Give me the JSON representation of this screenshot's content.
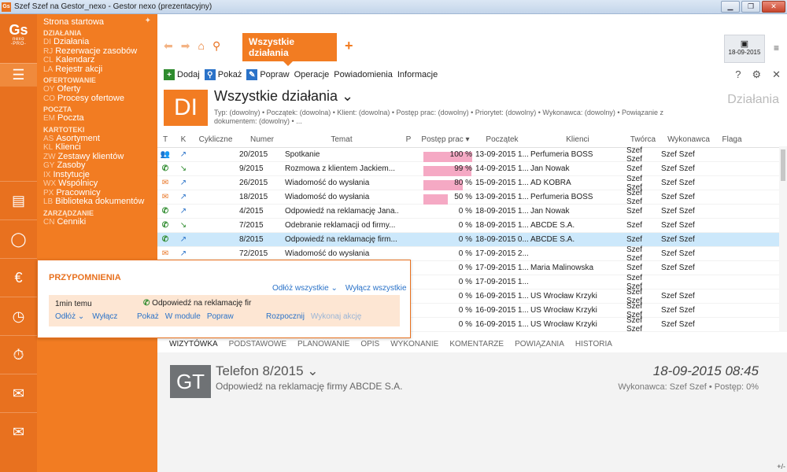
{
  "window": {
    "title": "Szef Szef na Gestor_nexo - Gestor nexo (prezentacyjny)",
    "app_badge": "Gs"
  },
  "logo": {
    "main": "Gs",
    "line1": "nexo",
    "line2": "-PRO-"
  },
  "nav": {
    "start": "Strona startowa",
    "sections": [
      {
        "title": "DZIAŁANIA",
        "items": [
          {
            "code": "DI",
            "label": "Działania"
          },
          {
            "code": "RJ",
            "label": "Rezerwacje zasobów"
          },
          {
            "code": "CL",
            "label": "Kalendarz"
          },
          {
            "code": "LA",
            "label": "Rejestr akcji"
          }
        ]
      },
      {
        "title": "OFERTOWANIE",
        "items": [
          {
            "code": "OY",
            "label": "Oferty"
          },
          {
            "code": "CO",
            "label": "Procesy ofertowe"
          }
        ]
      },
      {
        "title": "POCZTA",
        "items": [
          {
            "code": "EM",
            "label": "Poczta"
          }
        ]
      },
      {
        "title": "KARTOTEKI",
        "items": [
          {
            "code": "AS",
            "label": "Asortyment"
          },
          {
            "code": "KL",
            "label": "Klienci"
          },
          {
            "code": "ZW",
            "label": "Zestawy klientów"
          },
          {
            "code": "GY",
            "label": "Zasoby"
          },
          {
            "code": "IX",
            "label": "Instytucje"
          },
          {
            "code": "WX",
            "label": "Wspólnicy"
          },
          {
            "code": "PX",
            "label": "Pracownicy"
          },
          {
            "code": "LB",
            "label": "Biblioteka dokumentów"
          }
        ]
      },
      {
        "title": "ZARZĄDZANIE",
        "items": [
          {
            "code": "CN",
            "label": "Cenniki"
          }
        ]
      }
    ]
  },
  "tabs": {
    "active": "Wszystkie działania"
  },
  "datebox": {
    "date": "18-09-2015"
  },
  "commands": {
    "add": "Dodaj",
    "show": "Pokaż",
    "edit": "Popraw",
    "ops": "Operacje",
    "notif": "Powiadomienia",
    "info": "Informacje"
  },
  "header": {
    "badge": "DI",
    "title": "Wszystkie działania ⌄",
    "filter": "Typ: (dowolny) • Początek: (dowolna) • Klient: (dowolna) • Postęp prac: (dowolny) • Priorytet: (dowolny) • Wykonawca: (dowolny) • Powiązanie z dokumentem: (dowolny) • ...",
    "right": "Działania"
  },
  "columns": {
    "t": "T",
    "k": "K",
    "cyc": "Cykliczne",
    "num": "Numer",
    "tem": "Temat",
    "p": "P",
    "post": "Postęp prac ▾",
    "pocz": "Początek",
    "kli": "Klienci",
    "tw": "Twórca",
    "wyk": "Wykonawca",
    "fl": "Flaga"
  },
  "rows": [
    {
      "type": "person",
      "dir": "out",
      "num": "20/2015",
      "subject": "Spotkanie",
      "progress": 100,
      "progress_label": "100 %",
      "start": "13-09-2015 1...",
      "client": "Perfumeria BOSS",
      "creator": "Szef Szef",
      "executor": "Szef Szef"
    },
    {
      "type": "phone",
      "dir": "in",
      "num": "9/2015",
      "subject": "Rozmowa z klientem Jackiem...",
      "progress": 99,
      "progress_label": "99 %",
      "start": "14-09-2015 1...",
      "client": "Jan Nowak",
      "creator": "Szef",
      "executor": "Szef Szef"
    },
    {
      "type": "mail",
      "dir": "out",
      "num": "26/2015",
      "subject": "Wiadomość do wysłania",
      "progress": 80,
      "progress_label": "80 %",
      "start": "15-09-2015 1...",
      "client": "AD KOBRA",
      "creator": "Szef Szef",
      "executor": "Szef Szef"
    },
    {
      "type": "mail",
      "dir": "out",
      "num": "18/2015",
      "subject": "Wiadomość do wysłania",
      "progress": 50,
      "progress_label": "50 %",
      "start": "13-09-2015 1...",
      "client": "Perfumeria BOSS",
      "creator": "Szef Szef",
      "executor": "Szef Szef"
    },
    {
      "type": "phone",
      "dir": "out",
      "num": "4/2015",
      "subject": "Odpowiedź na reklamację Jana...",
      "progress": 0,
      "progress_label": "0 %",
      "start": "18-09-2015 1...",
      "client": "Jan Nowak",
      "creator": "Szef",
      "executor": "Szef Szef"
    },
    {
      "type": "phone",
      "dir": "in",
      "num": "7/2015",
      "subject": "Odebranie reklamacji od firmy...",
      "progress": 0,
      "progress_label": "0 %",
      "start": "18-09-2015 1...",
      "client": "ABCDE S.A.",
      "creator": "Szef",
      "executor": "Szef Szef"
    },
    {
      "type": "phone",
      "dir": "out",
      "num": "8/2015",
      "subject": "Odpowiedź na reklamację firm...",
      "progress": 0,
      "progress_label": "0 %",
      "start": "18-09-2015 0...",
      "client": "ABCDE S.A.",
      "creator": "Szef",
      "executor": "Szef Szef",
      "selected": true
    },
    {
      "type": "mail",
      "dir": "out",
      "num": "72/2015",
      "subject": "Wiadomość do wysłania",
      "progress": 0,
      "progress_label": "0 %",
      "start": "17-09-2015 2...",
      "client": "",
      "creator": "Szef Szef",
      "executor": "Szef Szef"
    },
    {
      "type": "",
      "dir": "",
      "num": "",
      "subject": "",
      "progress": 0,
      "progress_label": "0 %",
      "start": "17-09-2015 1...",
      "client": "Maria Malinowska",
      "creator": "Szef",
      "executor": "Szef Szef"
    },
    {
      "type": "",
      "dir": "",
      "num": "",
      "subject": "",
      "progress": 0,
      "progress_label": "0 %",
      "start": "17-09-2015 1...",
      "client": "",
      "creator": "Szef Szef",
      "executor": ""
    },
    {
      "type": "",
      "dir": "",
      "num": "",
      "subject": "",
      "progress": 0,
      "progress_label": "0 %",
      "start": "16-09-2015 1...",
      "client": "US Wrocław Krzyki",
      "creator": "Szef Szef",
      "executor": "Szef Szef"
    },
    {
      "type": "",
      "dir": "",
      "num": "",
      "subject": "",
      "progress": 0,
      "progress_label": "0 %",
      "start": "16-09-2015 1...",
      "client": "US Wrocław Krzyki",
      "creator": "Szef Szef",
      "executor": "Szef Szef"
    },
    {
      "type": "",
      "dir": "",
      "num": "",
      "subject": "",
      "progress": 0,
      "progress_label": "0 %",
      "start": "16-09-2015 1...",
      "client": "US Wrocław Krzyki",
      "creator": "Szef Szef",
      "executor": "Szef Szef"
    }
  ],
  "reminder": {
    "title": "PRZYPOMNIENIA",
    "snooze_all": "Odłóż wszystkie ⌄",
    "disable_all": "Wyłącz wszystkie",
    "time": "1min temu",
    "subject": "Odpowiedź na reklamację fir",
    "snooze": "Odłóż ⌄",
    "disable": "Wyłącz",
    "show": "Pokaż",
    "in_module": "W module",
    "edit": "Popraw",
    "start": "Rozpocznij",
    "do_action": "Wykonaj akcję"
  },
  "detail_tabs": [
    "WIZYTÓWKA",
    "PODSTAWOWE",
    "PLANOWANIE",
    "OPIS",
    "WYKONANIE",
    "KOMENTARZE",
    "POWIĄZANIA",
    "HISTORIA"
  ],
  "detail": {
    "badge": "GT",
    "title": "Telefon 8/2015 ⌄",
    "subtitle": "Odpowiedź na reklamację firmy ABCDE S.A.",
    "date": "18-09-2015 08:45",
    "executor_line": "Wykonawca: Szef Szef • Postęp: 0%",
    "plusminus": "+/-"
  }
}
